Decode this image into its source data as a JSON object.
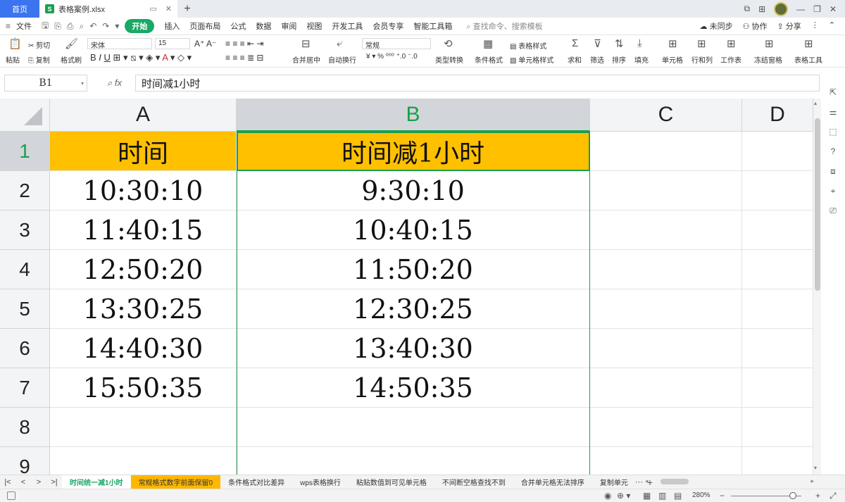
{
  "titlebar": {
    "home_tab": "首页",
    "file_icon": "S",
    "file_name": "表格案例.xlsx",
    "add_tab": "+"
  },
  "menu": {
    "file": "文件",
    "start": "开始",
    "items": [
      "插入",
      "页面布局",
      "公式",
      "数据",
      "审阅",
      "视图",
      "开发工具",
      "会员专享",
      "智能工具箱"
    ],
    "search_placeholder": "查找命令、搜索模板",
    "right": [
      "未同步",
      "协作",
      "分享"
    ]
  },
  "ribbon": {
    "paste": "粘贴",
    "cut": "剪切",
    "copy": "复制",
    "format_painter": "格式刷",
    "font_name": "宋体",
    "font_size": "15",
    "merge_center": "合并居中",
    "auto_wrap": "自动换行",
    "number_format": "常规",
    "type_convert": "类型转换",
    "conditional_format": "条件格式",
    "table_style": "表格样式",
    "cell_style": "单元格样式",
    "sum": "求和",
    "filter": "筛选",
    "sort": "排序",
    "fill": "填充",
    "cell": "单元格",
    "row_col": "行和列",
    "worksheet": "工作表",
    "freeze": "冻结窗格",
    "table_tools": "表格工具"
  },
  "formula_bar": {
    "cell_ref": "B1",
    "fx": "fx",
    "content": "时间减1小时"
  },
  "grid": {
    "columns": [
      "A",
      "B",
      "C",
      "D"
    ],
    "rows": [
      "1",
      "2",
      "3",
      "4",
      "5",
      "6",
      "7",
      "8",
      "9"
    ],
    "header": [
      "时间",
      "时间减1小时"
    ],
    "data": [
      [
        "10:30:10",
        "9:30:10"
      ],
      [
        "11:40:15",
        "10:40:15"
      ],
      [
        "12:50:20",
        "11:50:20"
      ],
      [
        "13:30:25",
        "12:30:25"
      ],
      [
        "14:40:30",
        "13:40:30"
      ],
      [
        "15:50:35",
        "14:50:35"
      ]
    ],
    "selected_column": "B",
    "selected_row": "1",
    "header_fill": "#ffc000",
    "accent": "#1a9f4d"
  },
  "sheets": {
    "tabs": [
      "时间统一减1小时",
      "常规格式数字前面保留0",
      "条件格式对比差异",
      "wps表格换行",
      "粘贴数值到可见单元格",
      "不间断空格查找不到",
      "合并单元格无法排序",
      "复制单元"
    ],
    "active_index": 0,
    "highlight_index": 1,
    "add": "+"
  },
  "status": {
    "zoom": "280%"
  }
}
